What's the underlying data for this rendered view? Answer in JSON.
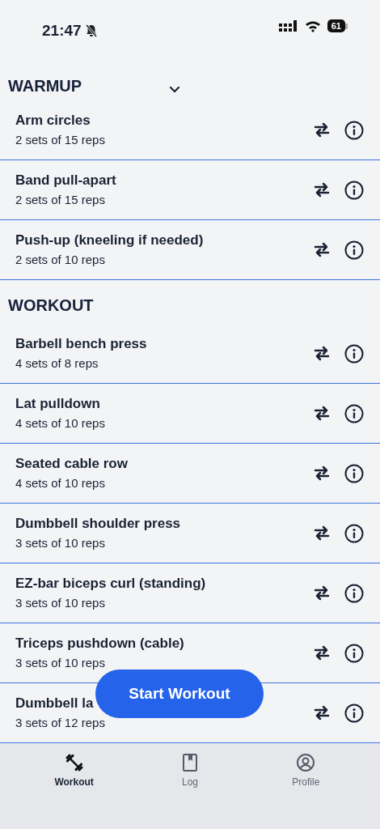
{
  "status_bar": {
    "time": "21:47",
    "battery": "61"
  },
  "sections": [
    {
      "title": "WARMUP",
      "collapsible": true,
      "exercises": [
        {
          "name": "Arm circles",
          "detail": "2 sets of 15 reps"
        },
        {
          "name": "Band pull-apart",
          "detail": "2 sets of 15 reps"
        },
        {
          "name": "Push-up (kneeling if needed)",
          "detail": "2 sets of 10 reps"
        }
      ]
    },
    {
      "title": "WORKOUT",
      "collapsible": false,
      "exercises": [
        {
          "name": "Barbell bench press",
          "detail": "4 sets of 8 reps"
        },
        {
          "name": "Lat pulldown",
          "detail": "4 sets of 10 reps"
        },
        {
          "name": "Seated cable row",
          "detail": "4 sets of 10 reps"
        },
        {
          "name": "Dumbbell shoulder press",
          "detail": "3 sets of 10 reps"
        },
        {
          "name": "EZ-bar biceps curl (standing)",
          "detail": "3 sets of 10 reps"
        },
        {
          "name": "Triceps pushdown (cable)",
          "detail": "3 sets of 10 reps"
        },
        {
          "name": "Dumbbell la",
          "detail": "3 sets of 12 reps"
        }
      ]
    }
  ],
  "start_button": "Start Workout",
  "tabs": [
    {
      "label": "Workout",
      "kind": "barbell",
      "selected": true
    },
    {
      "label": "Log",
      "kind": "book",
      "selected": false
    },
    {
      "label": "Profile",
      "kind": "person",
      "selected": false
    }
  ]
}
